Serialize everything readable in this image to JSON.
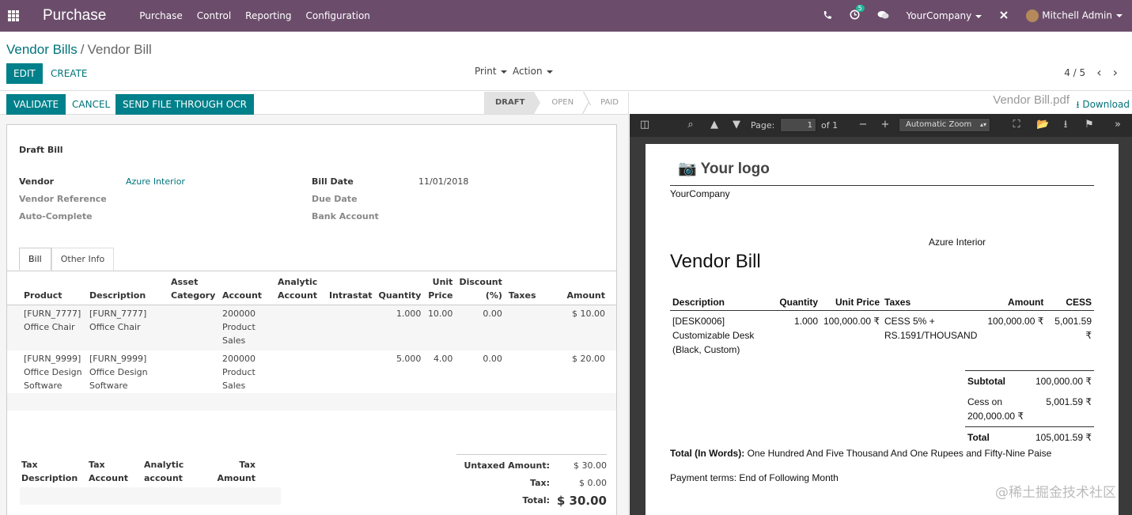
{
  "topbar": {
    "app_name": "Purchase",
    "menu": [
      "Purchase",
      "Control",
      "Reporting",
      "Configuration"
    ],
    "activity_count": "5",
    "company": "YourCompany",
    "user": "Mitchell Admin"
  },
  "breadcrumb": {
    "parent": "Vendor Bills",
    "separator": "/",
    "current": "Vendor Bill"
  },
  "buttons": {
    "edit": "EDIT",
    "create": "CREATE",
    "print": "Print",
    "action": "Action",
    "validate": "VALIDATE",
    "cancel": "CANCEL",
    "ocr": "SEND FILE THROUGH OCR"
  },
  "pager": {
    "value": "4 / 5"
  },
  "stages": [
    "DRAFT",
    "OPEN",
    "PAID"
  ],
  "form": {
    "title": "Draft Bill",
    "vendor_label": "Vendor",
    "vendor_value": "Azure Interior",
    "vendor_ref_label": "Vendor Reference",
    "auto_complete_label": "Auto-Complete",
    "bill_date_label": "Bill Date",
    "bill_date_value": "11/01/2018",
    "due_date_label": "Due Date",
    "bank_account_label": "Bank Account"
  },
  "tabs": [
    "Bill",
    "Other Info"
  ],
  "lines": {
    "headers": [
      "Product",
      "Description",
      "Asset Category",
      "Account",
      "Analytic Account",
      "Intrastat",
      "Quantity",
      "Unit Price",
      "Discount (%)",
      "Taxes",
      "Amount"
    ],
    "rows": [
      {
        "product": "[FURN_7777] Office Chair",
        "description": "[FURN_7777] Office Chair",
        "account": "200000 Product Sales",
        "quantity": "1.000",
        "unit_price": "10.00",
        "discount": "0.00",
        "amount": "$ 10.00"
      },
      {
        "product": "[FURN_9999] Office Design Software",
        "description": "[FURN_9999] Office Design Software",
        "account": "200000 Product Sales",
        "quantity": "5.000",
        "unit_price": "4.00",
        "discount": "0.00",
        "amount": "$ 20.00"
      }
    ]
  },
  "tax_table": {
    "headers": [
      "Tax Description",
      "Tax Account",
      "Analytic account",
      "Tax Amount"
    ]
  },
  "totals": {
    "untaxed_label": "Untaxed Amount:",
    "untaxed_value": "$ 30.00",
    "tax_label": "Tax:",
    "tax_value": "$ 0.00",
    "total_label": "Total:",
    "total_value": "$ 30.00"
  },
  "attachment": {
    "name": "Vendor Bill.pdf",
    "download": "Download"
  },
  "pdf_toolbar": {
    "page_label": "Page:",
    "page_value": "1",
    "of_label": "of 1",
    "zoom": "Automatic Zoom"
  },
  "pdf": {
    "logo": "Your logo",
    "company": "YourCompany",
    "partner": "Azure Interior",
    "title": "Vendor Bill",
    "headers": [
      "Description",
      "Quantity",
      "Unit Price",
      "Taxes",
      "Amount",
      "CESS"
    ],
    "row": {
      "description": "[DESK0006] Customizable Desk (Black, Custom)",
      "quantity": "1.000",
      "unit_price": "100,000.00 ₹",
      "taxes": "CESS 5% + RS.1591/THOUSAND",
      "amount": "100,000.00 ₹",
      "cess": "5,001.59 ₹"
    },
    "subtotal_label": "Subtotal",
    "subtotal_value": "100,000.00 ₹",
    "cess_label": "Cess on 200,000.00 ₹",
    "cess_value": "5,001.59 ₹",
    "total_label": "Total",
    "total_value": "105,001.59 ₹",
    "words_label": "Total (In Words):",
    "words_value": "One Hundred And Five Thousand And One Rupees and Fifty-Nine Paise",
    "terms": "Payment terms: End of Following Month"
  },
  "watermark": "@稀土掘金技术社区",
  "colors": {
    "topbar": "#6b4d6b",
    "primary": "#00808a",
    "link": "#00737a"
  }
}
